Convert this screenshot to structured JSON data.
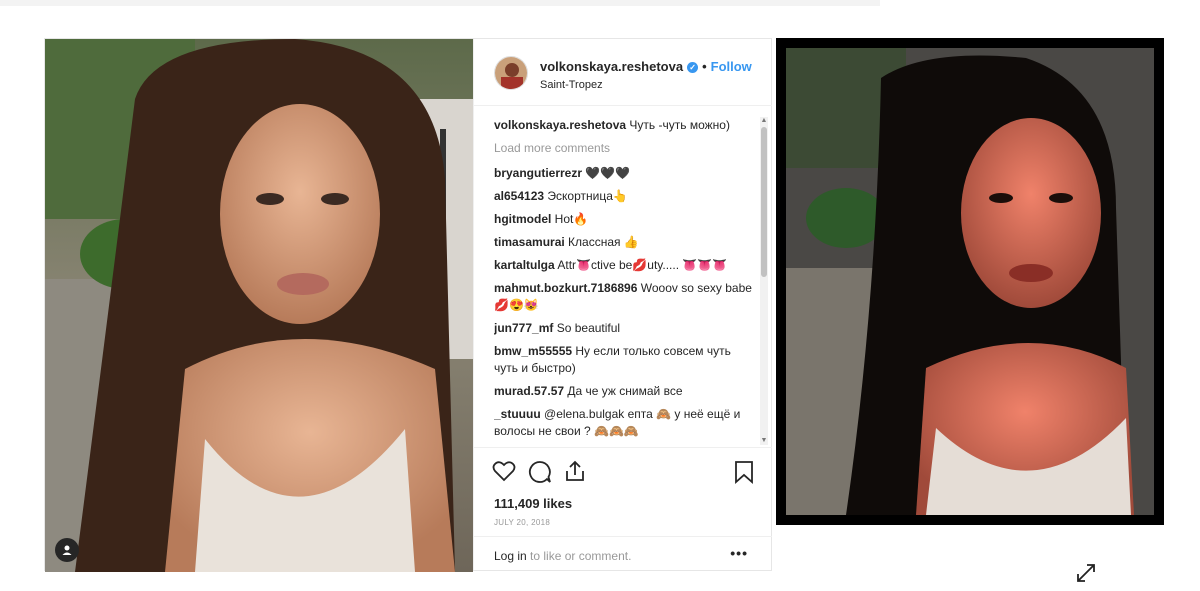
{
  "post": {
    "username": "volkonskaya.reshetova",
    "verified_mark": "✓",
    "follow_separator": "•",
    "follow_label": "Follow",
    "location": "Saint-Tropez",
    "load_more": "Load more comments",
    "comments": [
      {
        "user": "volkonskaya.reshetova",
        "text": "Чуть -чуть можно)"
      },
      {
        "user": "bryangutierrezr",
        "text": "🖤🖤🖤"
      },
      {
        "user": "al654123",
        "text": "Эскортница👆"
      },
      {
        "user": "hgitmodel",
        "text": "Hot🔥"
      },
      {
        "user": "timasamurai",
        "text": "Классная 👍"
      },
      {
        "user": "kartaltulga",
        "text": "Attr👅ctive be💋uty..... 👅👅👅"
      },
      {
        "user": "mahmut.bozkurt.7186896",
        "text": "Wooov so sexy babe 💋😍😻"
      },
      {
        "user": "jun777_mf",
        "text": "So beautiful"
      },
      {
        "user": "bmw_m55555",
        "text": "Ну если только совсем чуть чуть и быстро)"
      },
      {
        "user": "murad.57.57",
        "text": "Да че уж снимай все"
      },
      {
        "user": "_stuuuu",
        "text": "@elena.bulgak епта 🙈 у неё ещё и волосы не свои ? 🙈🙈🙈"
      }
    ],
    "likes": "111,409 likes",
    "date": "JULY 20, 2018",
    "login_link": "Log in",
    "login_rest": " to like or comment.",
    "more_options": "•••"
  },
  "icons": {
    "like": "heart-icon",
    "comment": "comment-icon",
    "share": "share-icon",
    "save": "bookmark-icon",
    "user_tag": "user-tag-icon",
    "expand": "expand-icon"
  },
  "colors": {
    "accent": "#3897f0",
    "text": "#262626",
    "muted": "#999999"
  }
}
